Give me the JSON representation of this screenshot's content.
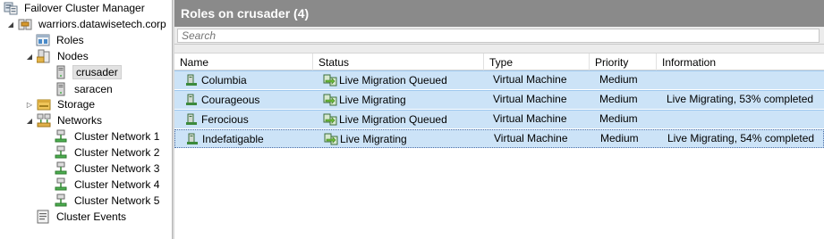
{
  "tree": {
    "root": {
      "label": "Failover Cluster Manager",
      "icon": "cluster-manager-icon"
    },
    "cluster": {
      "label": "warriors.datawisetech.corp",
      "icon": "cluster-icon",
      "expander": "◢"
    },
    "roles": {
      "label": "Roles",
      "icon": "roles-icon"
    },
    "nodes": {
      "label": "Nodes",
      "icon": "nodes-icon",
      "expander": "◢"
    },
    "node_items": [
      {
        "label": "crusader",
        "icon": "server-icon",
        "selected": true
      },
      {
        "label": "saracen",
        "icon": "server-icon",
        "selected": false
      }
    ],
    "storage": {
      "label": "Storage",
      "icon": "storage-icon",
      "expander": "▷"
    },
    "networks": {
      "label": "Networks",
      "icon": "networks-icon",
      "expander": "◢"
    },
    "network_items": [
      {
        "label": "Cluster Network 1",
        "icon": "network-icon"
      },
      {
        "label": "Cluster Network 2",
        "icon": "network-icon"
      },
      {
        "label": "Cluster Network 3",
        "icon": "network-icon"
      },
      {
        "label": "Cluster Network 4",
        "icon": "network-icon"
      },
      {
        "label": "Cluster Network 5",
        "icon": "network-icon"
      }
    ],
    "events": {
      "label": "Cluster Events",
      "icon": "cluster-events-icon"
    }
  },
  "panel": {
    "title": "Roles on crusader (4)",
    "search_placeholder": "Search",
    "columns": [
      "Name",
      "Status",
      "Type",
      "Priority",
      "Information"
    ],
    "rows": [
      {
        "name": "Columbia",
        "status": "Live Migration Queued",
        "type": "Virtual Machine",
        "priority": "Medium",
        "information": ""
      },
      {
        "name": "Courageous",
        "status": "Live Migrating",
        "type": "Virtual Machine",
        "priority": "Medium",
        "information": "Live Migrating, 53% completed"
      },
      {
        "name": "Ferocious",
        "status": "Live Migration Queued",
        "type": "Virtual Machine",
        "priority": "Medium",
        "information": ""
      },
      {
        "name": "Indefatigable",
        "status": "Live Migrating",
        "type": "Virtual Machine",
        "priority": "Medium",
        "information": "Live Migrating, 54% completed"
      }
    ]
  },
  "colors": {
    "header_bg": "#8a8a8a",
    "row_selected_bg": "#cce3f7",
    "row_border": "#9ec8ee",
    "vm_icon": "#3c8a3c",
    "migrate_icon": "#6fbf3a"
  }
}
